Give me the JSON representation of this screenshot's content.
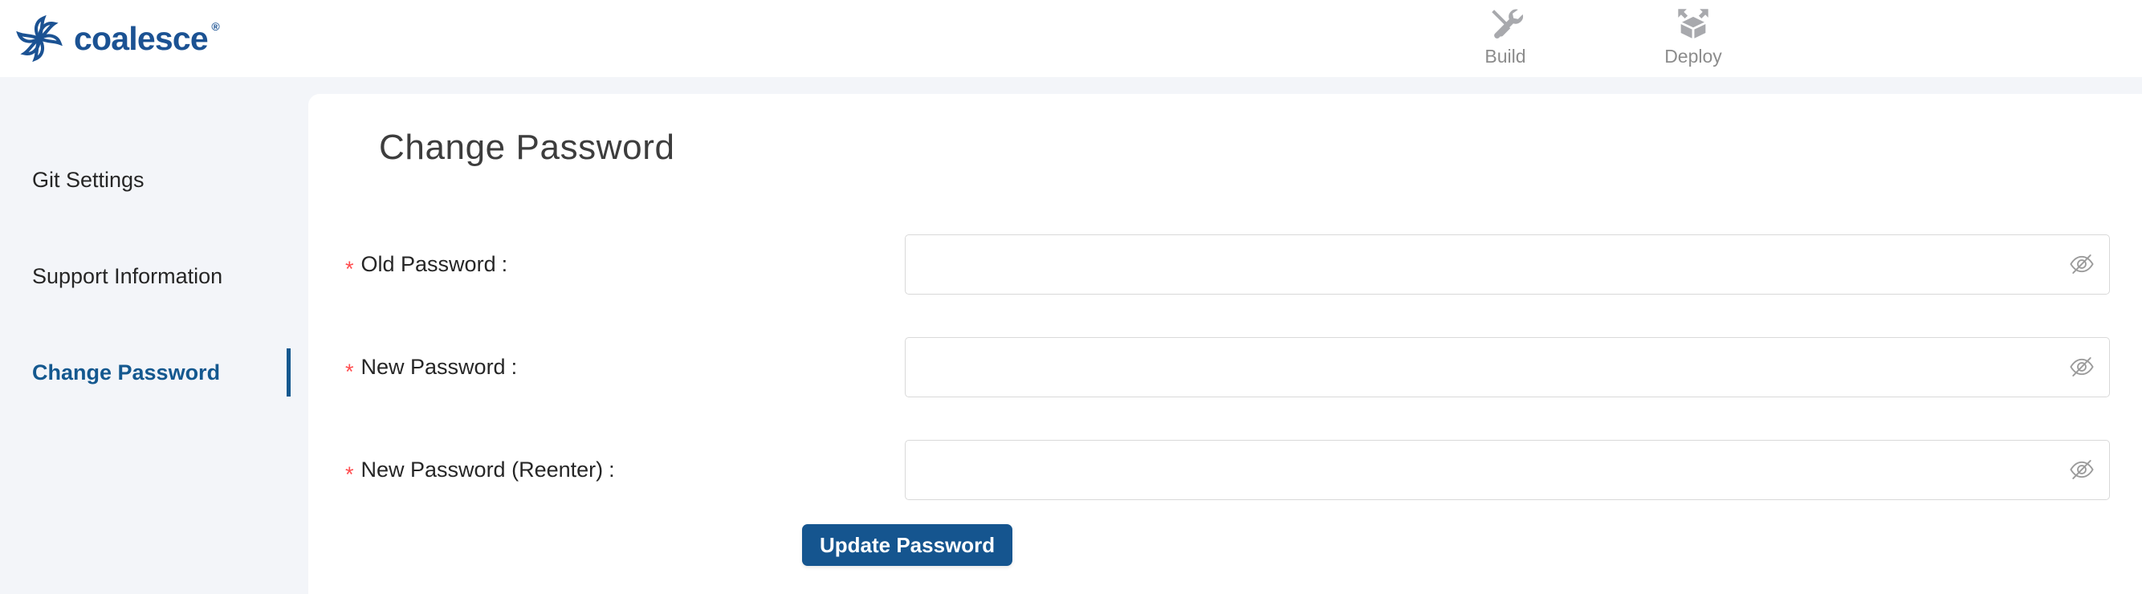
{
  "header": {
    "brand": {
      "name": "coalesce",
      "registered_mark": "®",
      "logo_icon": "coalesce-pinwheel-logo-icon",
      "color": "#1b5293"
    },
    "nav": [
      {
        "label": "Build",
        "icon": "wrench-screwdriver-icon"
      },
      {
        "label": "Deploy",
        "icon": "deploy-box-arrows-icon"
      }
    ],
    "nav_color": "#8c8c8c"
  },
  "sidebar": {
    "items": [
      {
        "label": "Git Settings",
        "active": false
      },
      {
        "label": "Support Information",
        "active": false
      },
      {
        "label": "Change Password",
        "active": true
      }
    ],
    "active_color": "#14588f",
    "background": "#f3f5f9"
  },
  "main": {
    "title": "Change Password",
    "form": {
      "required_marker": "*",
      "colon": ":",
      "fields": [
        {
          "label": "Old Password",
          "value": "",
          "placeholder": "",
          "type": "password",
          "required": true,
          "toggle_icon": "eye-slash-icon"
        },
        {
          "label": "New Password",
          "value": "",
          "placeholder": "",
          "type": "password",
          "required": true,
          "toggle_icon": "eye-slash-icon"
        },
        {
          "label": "New Password (Reenter)",
          "value": "",
          "placeholder": "",
          "type": "password",
          "required": true,
          "toggle_icon": "eye-slash-icon"
        }
      ],
      "submit_label": "Update Password",
      "submit_color": "#15558f",
      "required_color": "#ff4d4f"
    }
  }
}
